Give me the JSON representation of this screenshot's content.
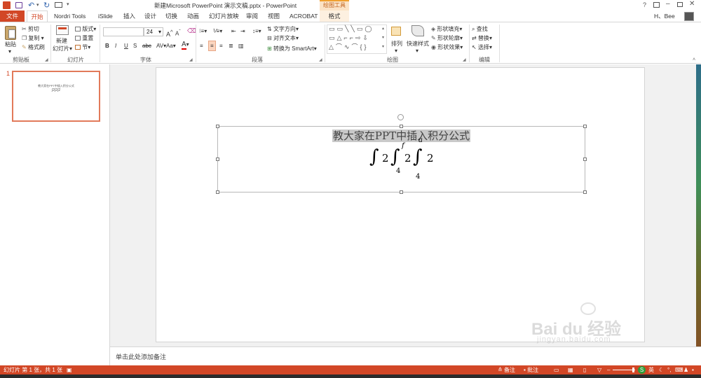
{
  "window": {
    "title": "新建Microsoft PowerPoint 演示文稿.pptx - PowerPoint",
    "contextual_tab_group": "绘图工具",
    "user": "H、Bee",
    "help": "?"
  },
  "tabs": [
    {
      "label": "文件",
      "active": false,
      "file": true
    },
    {
      "label": "开始",
      "active": true
    },
    {
      "label": "Nordri Tools"
    },
    {
      "label": "iSlide"
    },
    {
      "label": "插入"
    },
    {
      "label": "设计"
    },
    {
      "label": "切换"
    },
    {
      "label": "动画"
    },
    {
      "label": "幻灯片放映"
    },
    {
      "label": "审阅"
    },
    {
      "label": "视图"
    },
    {
      "label": "ACROBAT"
    },
    {
      "label": "格式"
    }
  ],
  "ribbon": {
    "clipboard": {
      "label": "剪贴板",
      "paste": "粘贴",
      "cut": "剪切",
      "copy": "复制",
      "format_painter": "格式刷"
    },
    "slides": {
      "label": "幻灯片",
      "new_slide_1": "新建",
      "new_slide_2": "幻灯片",
      "layout": "版式",
      "reset": "重置",
      "section": "节"
    },
    "font": {
      "label": "字体",
      "font_name": "",
      "font_size": "24",
      "bold": "B",
      "italic": "I",
      "underline": "U",
      "shadow": "S",
      "strike": "abc",
      "spacing": "AV",
      "case": "Aa",
      "color": "A",
      "grow": "A",
      "shrink": "A"
    },
    "paragraph": {
      "label": "段落",
      "text_direction": "文字方向",
      "align_text": "对齐文本",
      "smartart": "转换为 SmartArt"
    },
    "drawing": {
      "label": "绘图",
      "arrange": "排列",
      "quick_styles": "快速样式",
      "shape_fill": "形状填充",
      "shape_outline": "形状轮廓",
      "shape_effects": "形状效果"
    },
    "editing": {
      "label": "编辑",
      "find": "查找",
      "replace": "替换",
      "select": "选择"
    }
  },
  "thumbnail": {
    "number": "1",
    "title": "教大家在PPT中插入积分公式"
  },
  "slide": {
    "title": "教大家在PPT中插入积分公式",
    "formula": {
      "int1": "∫",
      "num1": "2",
      "int2": "∫",
      "upper2": "f",
      "lower2": "4",
      "num2": "2",
      "int3": "∫",
      "upper3": "a",
      "lower3": "4",
      "num3": "2"
    }
  },
  "notes": {
    "placeholder": "单击此处添加备注"
  },
  "status": {
    "slide_info": "幻灯片 第 1 张，共 1 张",
    "notes_btn": "备注",
    "comments_btn": "批注",
    "ime": "英"
  },
  "watermark": {
    "logo": "Bai du 经验",
    "url": "jingyan.baidu.com"
  },
  "colors": {
    "accent": "#d24726",
    "contextual": "#f0a030"
  }
}
